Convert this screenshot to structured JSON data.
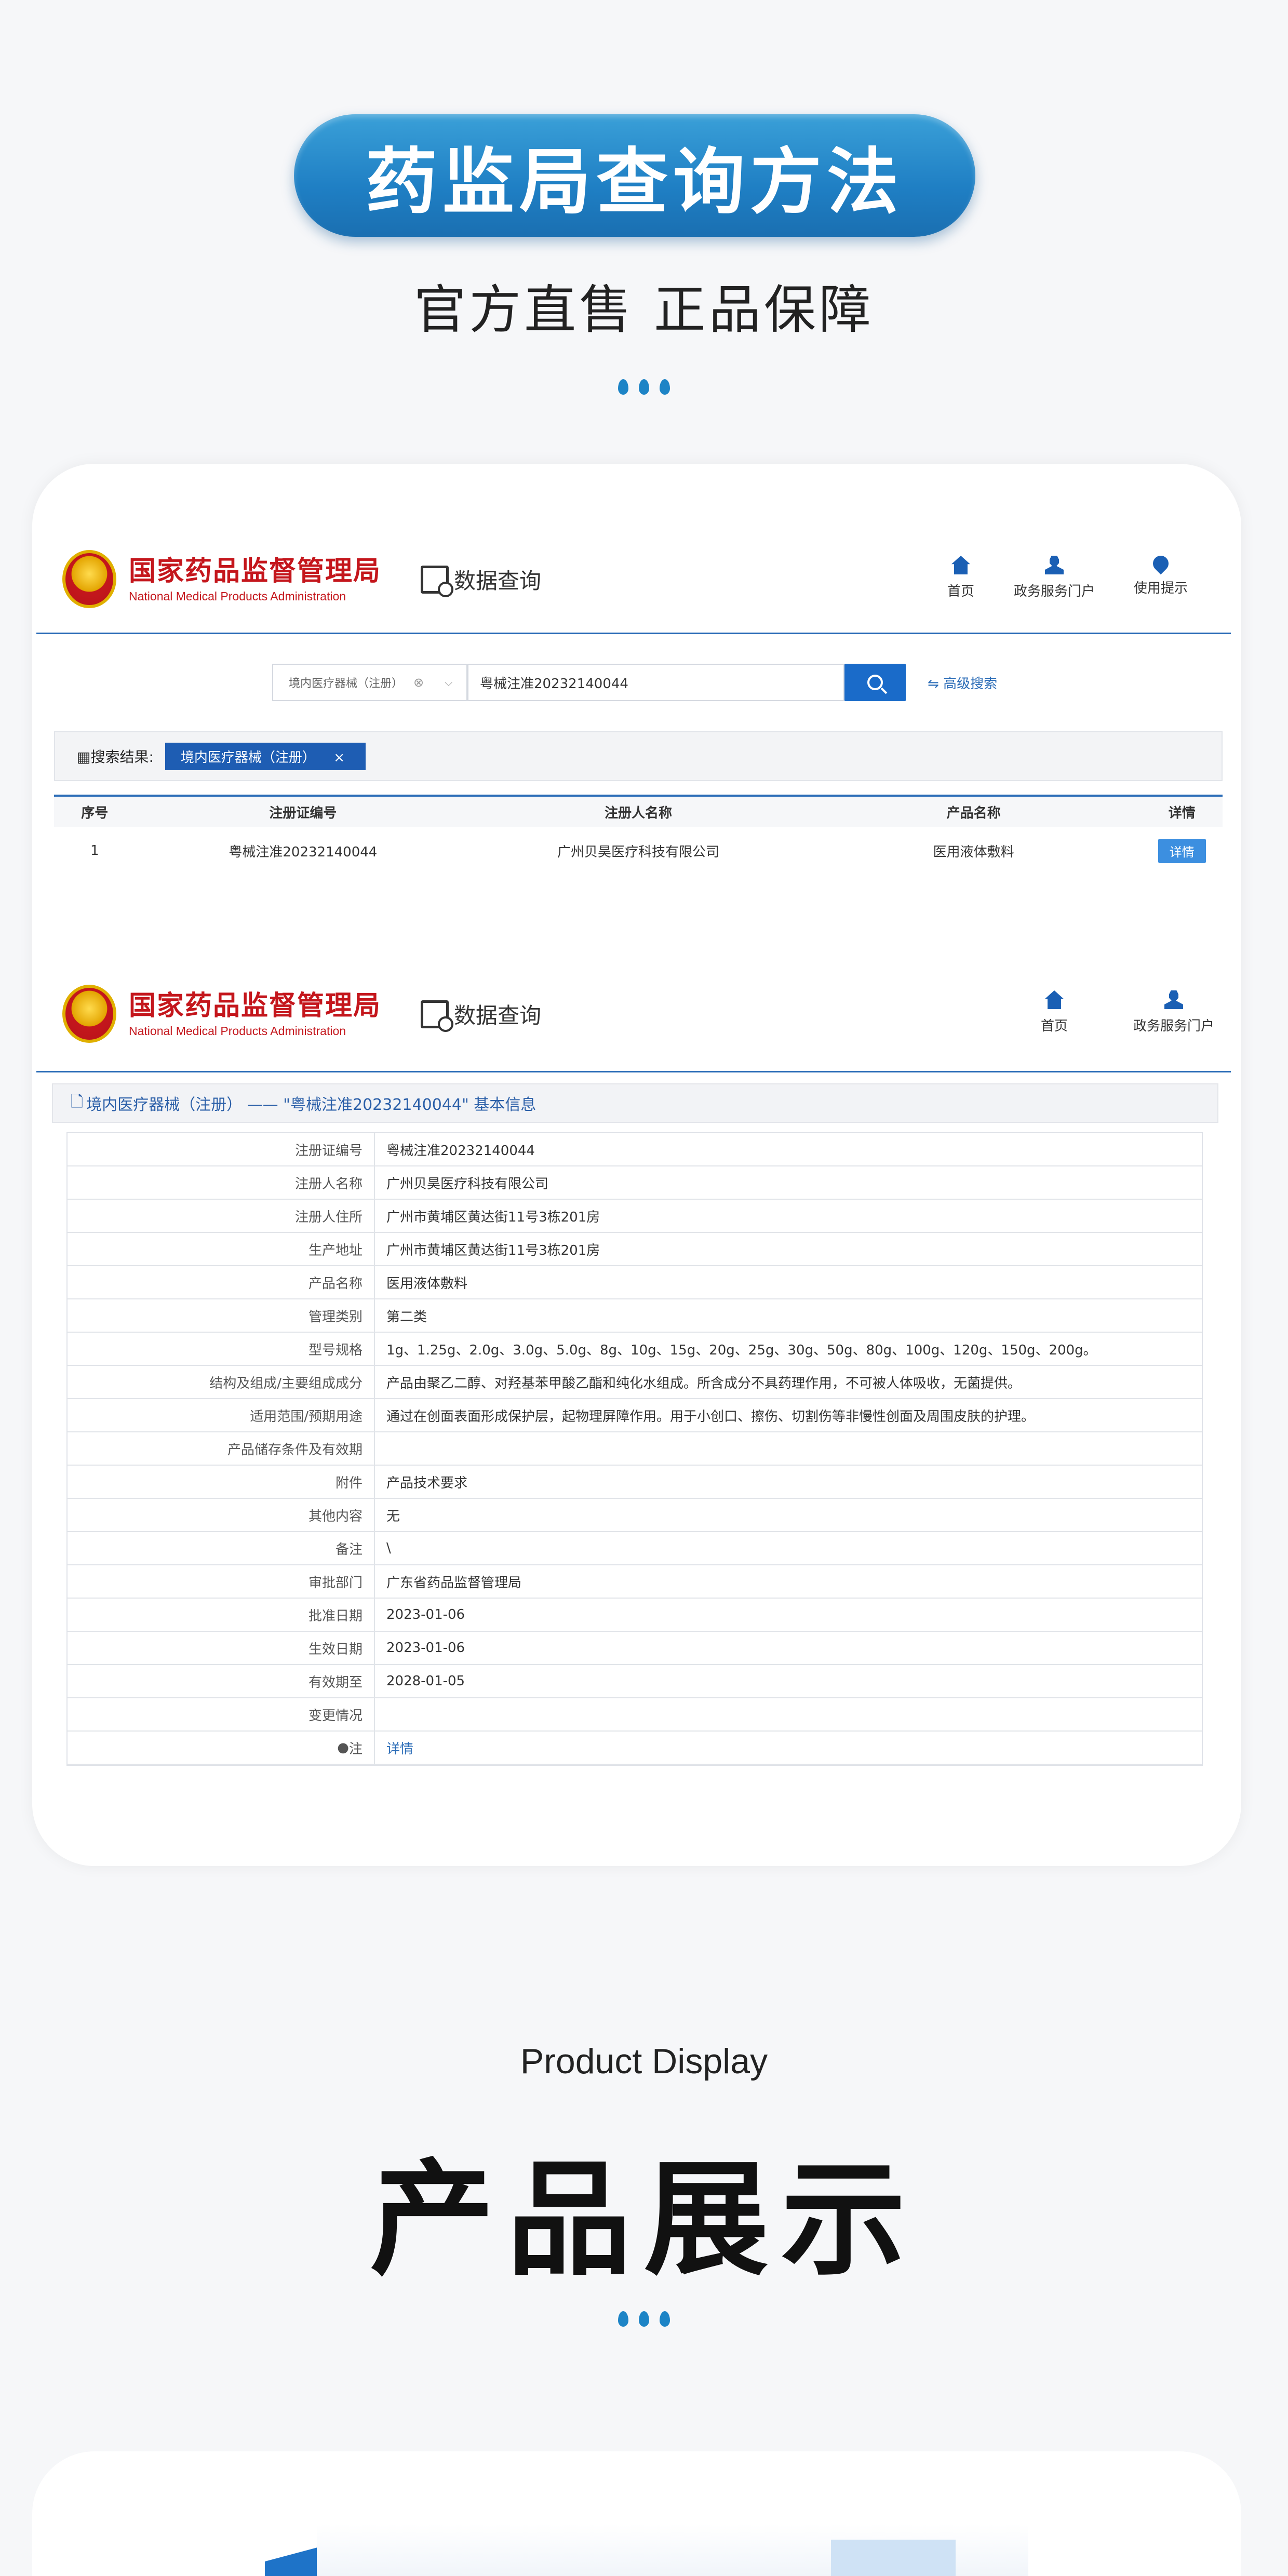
{
  "hero": {
    "title": "药监局查询方法",
    "subtitle": "官方直售 正品保障"
  },
  "site": {
    "org_cn": "国家药品监督管理局",
    "org_en": "National Medical Products Administration",
    "data_query": "数据查询",
    "nav": [
      {
        "label": "首页",
        "icon": "home-icon"
      },
      {
        "label": "政务服务门户",
        "icon": "user-icon"
      },
      {
        "label": "使用提示",
        "icon": "location-pin-icon"
      }
    ]
  },
  "search": {
    "category": "境内医疗器械（注册）",
    "query": "粤械注准20232140044",
    "advanced": "高级搜索"
  },
  "results": {
    "label": "搜索结果:",
    "tag": "境内医疗器械（注册）",
    "columns": [
      "序号",
      "注册证编号",
      "注册人名称",
      "产品名称",
      "详情"
    ],
    "rows": [
      {
        "no": "1",
        "reg_no": "粤械注准20232140044",
        "registrant": "广州贝昊医疗科技有限公司",
        "product": "医用液体敷料",
        "action": "详情"
      }
    ]
  },
  "detail": {
    "breadcrumb": "境内医疗器械（注册） —— \"粤械注准20232140044\" 基本信息",
    "rows": [
      {
        "label": "注册证编号",
        "value": "粤械注准20232140044"
      },
      {
        "label": "注册人名称",
        "value": "广州贝昊医疗科技有限公司"
      },
      {
        "label": "注册人住所",
        "value": "广州市黄埔区黄达街11号3栋201房"
      },
      {
        "label": "生产地址",
        "value": "广州市黄埔区黄达街11号3栋201房"
      },
      {
        "label": "产品名称",
        "value": "医用液体敷料"
      },
      {
        "label": "管理类别",
        "value": "第二类"
      },
      {
        "label": "型号规格",
        "value": "1g、1.25g、2.0g、3.0g、5.0g、8g、10g、15g、20g、25g、30g、50g、80g、100g、120g、150g、200g。"
      },
      {
        "label": "结构及组成/主要组成成分",
        "value": "产品由聚乙二醇、对羟基苯甲酸乙酯和纯化水组成。所含成分不具药理作用，不可被人体吸收，无菌提供。"
      },
      {
        "label": "适用范围/预期用途",
        "value": "通过在创面表面形成保护层，起物理屏障作用。用于小创口、擦伤、切割伤等非慢性创面及周围皮肤的护理。"
      },
      {
        "label": "产品储存条件及有效期",
        "value": ""
      },
      {
        "label": "附件",
        "value": "产品技术要求"
      },
      {
        "label": "其他内容",
        "value": "无"
      },
      {
        "label": "备注",
        "value": "\\"
      },
      {
        "label": "审批部门",
        "value": "广东省药品监督管理局"
      },
      {
        "label": "批准日期",
        "value": "2023-01-06"
      },
      {
        "label": "生效日期",
        "value": "2023-01-06"
      },
      {
        "label": "有效期至",
        "value": "2028-01-05"
      },
      {
        "label": "变更情况",
        "value": ""
      },
      {
        "label": "注",
        "value": "详情"
      }
    ]
  },
  "product": {
    "title_en": "Product Display",
    "title_cn": "产品展示"
  },
  "colors": {
    "primary": "#1f7fc4",
    "nav_blue": "#1a5fb4",
    "org_red": "#c4161c"
  }
}
